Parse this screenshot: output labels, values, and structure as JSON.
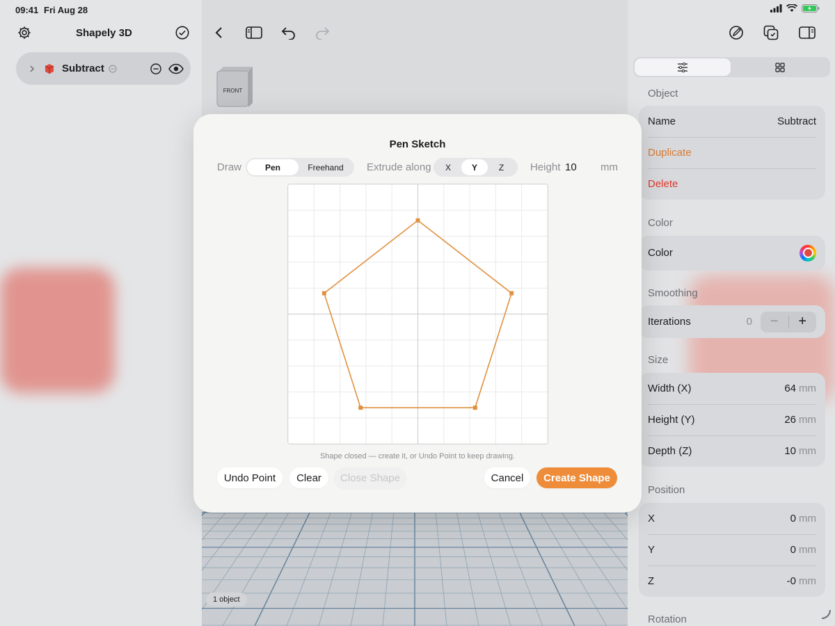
{
  "status": {
    "time": "09:41",
    "date": "Fri Aug 28"
  },
  "sidebar": {
    "title": "Shapely 3D",
    "items": [
      {
        "label": "Subtract"
      }
    ]
  },
  "viewcube": {
    "face": "FRONT"
  },
  "footer": {
    "object_count": "1 object"
  },
  "panel": {
    "object": {
      "header": "Object",
      "name_label": "Name",
      "name_value": "Subtract",
      "duplicate": "Duplicate",
      "delete": "Delete"
    },
    "color": {
      "header": "Color",
      "label": "Color"
    },
    "smoothing": {
      "header": "Smoothing",
      "label": "Iterations",
      "value": "0",
      "minus": "−",
      "plus": "+"
    },
    "size": {
      "header": "Size",
      "rows": [
        {
          "label": "Width (X)",
          "value": "64",
          "unit": "mm"
        },
        {
          "label": "Height (Y)",
          "value": "26",
          "unit": "mm"
        },
        {
          "label": "Depth (Z)",
          "value": "10",
          "unit": "mm"
        }
      ]
    },
    "position": {
      "header": "Position",
      "rows": [
        {
          "label": "X",
          "value": "0",
          "unit": "mm"
        },
        {
          "label": "Y",
          "value": "0",
          "unit": "mm"
        },
        {
          "label": "Z",
          "value": "-0",
          "unit": "mm"
        }
      ]
    },
    "rotation": {
      "header": "Rotation"
    }
  },
  "modal": {
    "title": "Pen Sketch",
    "draw_label": "Draw",
    "draw_options": [
      "Pen",
      "Freehand"
    ],
    "draw_selected": "Pen",
    "extrude_label": "Extrude along",
    "extrude_options": [
      "X",
      "Y",
      "Z"
    ],
    "extrude_selected": "Y",
    "height_label": "Height",
    "height_value": "10",
    "height_unit": "mm",
    "hint": "Shape closed — create it, or Undo Point to keep drawing.",
    "buttons": {
      "undo_point": "Undo Point",
      "clear": "Clear",
      "close_shape": "Close Shape",
      "cancel": "Cancel",
      "create_shape": "Create Shape"
    },
    "sketch": {
      "stroke_color": "#e0913f",
      "grid_divisions": 10,
      "points": [
        [
          0,
          3.6
        ],
        [
          3.6,
          0.8
        ],
        [
          2.2,
          -3.6
        ],
        [
          -2.2,
          -3.6
        ],
        [
          -3.6,
          0.8
        ]
      ]
    }
  },
  "colors": {
    "accent": "#ee8c3a",
    "destructive": "#e0382e",
    "duplicate": "#d9792f"
  }
}
